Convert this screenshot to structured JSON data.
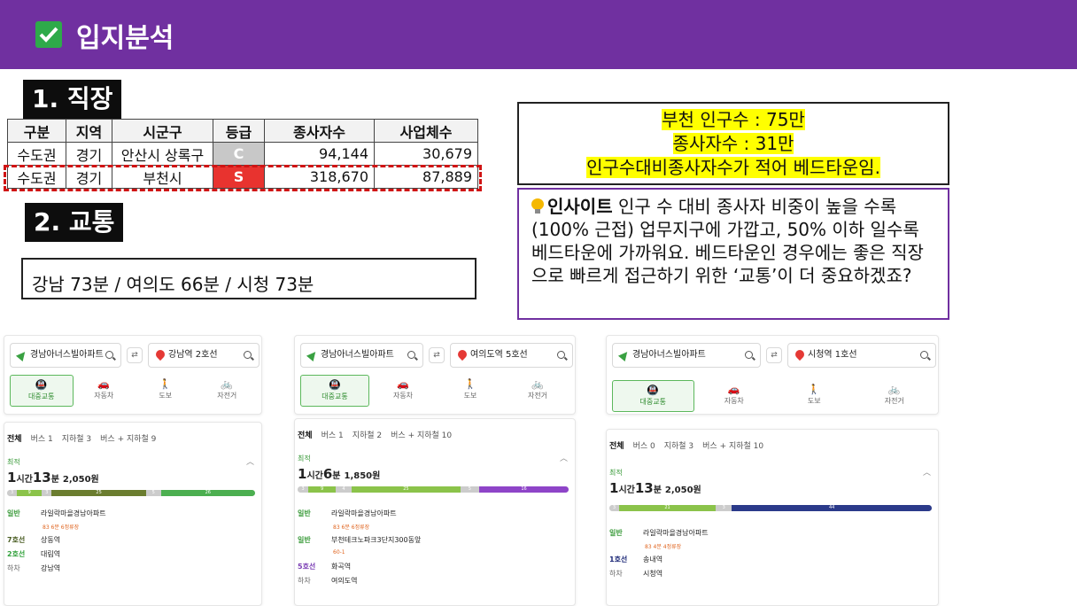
{
  "header": {
    "title": "입지분석"
  },
  "section1": {
    "label": "1. 직장"
  },
  "section2": {
    "label": "2. 교통"
  },
  "table": {
    "headers": [
      "구분",
      "지역",
      "시군구",
      "등급",
      "종사자수",
      "사업체수"
    ],
    "rows": [
      [
        "수도권",
        "경기",
        "안산시 상록구",
        "C",
        "94,144",
        "30,679"
      ],
      [
        "수도권",
        "경기",
        "부천시",
        "S",
        "318,670",
        "87,889"
      ]
    ]
  },
  "traffic": {
    "text": "강남 73분 / 여의도 66분 / 시청 73분"
  },
  "population": {
    "line1": "부천 인구수 : 75만",
    "line2": "종사자수 : 31만",
    "line3": "인구수대비종사자수가 적어 베드타운임."
  },
  "insight": {
    "title": "인사이트",
    "text": " 인구 수 대비 종사자 비중이 높을 수록(100% 근접) 업무지구에 가깝고, 50% 이하 일수록 베드타운에 가까워요. 베드타운인 경우에는 좋은 직장으로 빠르게 접근하기 위한 ‘교통’이 더 중요하겠죠?"
  },
  "modes": [
    "대중교통",
    "자동차",
    "도보",
    "자전거"
  ],
  "mode_icons": [
    "bus-icon",
    "car-icon",
    "walk-icon",
    "bike-icon"
  ],
  "routes": [
    {
      "origin": "경남아너스빌아파트",
      "destination": "강남역 2호선",
      "tabs": [
        "전체",
        "버스 1",
        "지하철 3",
        "버스 + 지하철 9"
      ],
      "best": "최적",
      "hours": "1",
      "hour_unit": "시간",
      "minutes": "13",
      "minute_unit": "분",
      "fare": "2,050원",
      "segments": [
        {
          "label": "3",
          "color": "#cccccc",
          "frac": 0.04
        },
        {
          "label": "9",
          "color": "#8bc34a",
          "frac": 0.1
        },
        {
          "label": "3",
          "color": "#cccccc",
          "frac": 0.04
        },
        {
          "label": "25",
          "color": "#6b7d2f",
          "frac": 0.38
        },
        {
          "label": "5",
          "color": "#cccccc",
          "frac": 0.06
        },
        {
          "label": "26",
          "color": "#4caf50",
          "frac": 0.38
        }
      ],
      "steps": [
        {
          "tag": "일반",
          "tag_class": "bus",
          "text": "라일락마을경남아파트"
        },
        {
          "tag": "",
          "tag_class": "bus",
          "text": "83  6분 6정류장",
          "sub": true
        },
        {
          "tag": "7호선",
          "tag_class": "l7",
          "text": "상동역"
        },
        {
          "tag": "2호선",
          "tag_class": "l2",
          "text": "대림역"
        },
        {
          "tag": "하차",
          "tag_class": "off",
          "text": "강남역"
        }
      ]
    },
    {
      "origin": "경남아너스빌아파트",
      "destination": "여의도역 5호선",
      "tabs": [
        "전체",
        "버스 1",
        "지하철 2",
        "버스 + 지하철 10"
      ],
      "best": "최적",
      "hours": "1",
      "hour_unit": "시간",
      "minutes": "6",
      "minute_unit": "분",
      "fare": "1,850원",
      "segments": [
        {
          "label": "3",
          "color": "#cccccc",
          "frac": 0.04
        },
        {
          "label": "9",
          "color": "#8bc34a",
          "frac": 0.1
        },
        {
          "label": "4",
          "color": "#cccccc",
          "frac": 0.06
        },
        {
          "label": "25",
          "color": "#8bc34a",
          "frac": 0.4
        },
        {
          "label": "5",
          "color": "#cccccc",
          "frac": 0.07
        },
        {
          "label": "16",
          "color": "#8e44c8",
          "frac": 0.33
        }
      ],
      "steps": [
        {
          "tag": "일반",
          "tag_class": "bus",
          "text": "라일락마을경남아파트"
        },
        {
          "tag": "",
          "tag_class": "bus",
          "text": "83  6분 6정류장",
          "sub": true
        },
        {
          "tag": "일반",
          "tag_class": "bus",
          "text": "부천테크노파크3단지300동앞"
        },
        {
          "tag": "",
          "tag_class": "bus",
          "text": "60-1",
          "sub": true
        },
        {
          "tag": "5호선",
          "tag_class": "l5",
          "text": "화곡역"
        },
        {
          "tag": "하차",
          "tag_class": "off",
          "text": "여의도역"
        }
      ]
    },
    {
      "origin": "경남아너스빌아파트",
      "destination": "시청역 1호선",
      "tabs": [
        "전체",
        "버스 0",
        "지하철 3",
        "버스 + 지하철 10"
      ],
      "best": "최적",
      "hours": "1",
      "hour_unit": "시간",
      "minutes": "13",
      "minute_unit": "분",
      "fare": "2,050원",
      "segments": [
        {
          "label": "3",
          "color": "#cccccc",
          "frac": 0.03
        },
        {
          "label": "21",
          "color": "#8bc34a",
          "frac": 0.3
        },
        {
          "label": "3",
          "color": "#cccccc",
          "frac": 0.05
        },
        {
          "label": "44",
          "color": "#2b3a8a",
          "frac": 0.62
        }
      ],
      "steps": [
        {
          "tag": "일반",
          "tag_class": "bus",
          "text": "라일락마을경남아파트"
        },
        {
          "tag": "",
          "tag_class": "bus",
          "text": "83  4분 4정류장",
          "sub": true
        },
        {
          "tag": "1호선",
          "tag_class": "l1",
          "text": "송내역"
        },
        {
          "tag": "하차",
          "tag_class": "off",
          "text": "시청역"
        }
      ]
    }
  ]
}
